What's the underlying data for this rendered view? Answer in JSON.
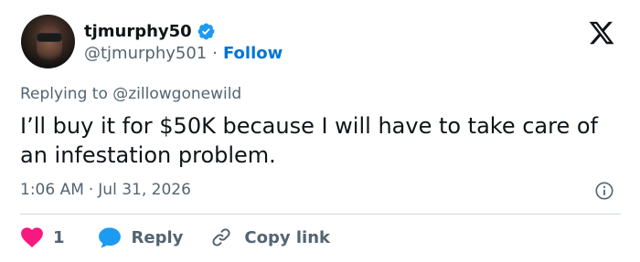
{
  "author": {
    "display_name": "tjmurphy50",
    "handle": "@tjmurphy501",
    "separator": "·",
    "follow_label": "Follow",
    "verified": true
  },
  "reply_context": {
    "prefix": "Replying to",
    "mention": "@zillowgonewild"
  },
  "tweet": {
    "text": "I’ll buy it for $50K because I will have to take care of an infestation problem."
  },
  "meta": {
    "time": "1:06 AM",
    "separator": "·",
    "date": "Jul 31, 2026"
  },
  "actions": {
    "like_count": "1",
    "reply_label": "Reply",
    "copy_label": "Copy link"
  },
  "colors": {
    "heart": "#f91880",
    "reply_bubble": "#1d9bf0",
    "follow_link": "#0074d4",
    "verified_badge": "#1d9bf0",
    "muted_text": "#536471",
    "primary_text": "#0f1419"
  },
  "icons": {
    "platform_logo": "x-logo-icon",
    "verified": "verified-badge-icon",
    "info": "info-icon",
    "like": "heart-icon",
    "reply": "speech-bubble-icon",
    "copy": "link-icon"
  }
}
